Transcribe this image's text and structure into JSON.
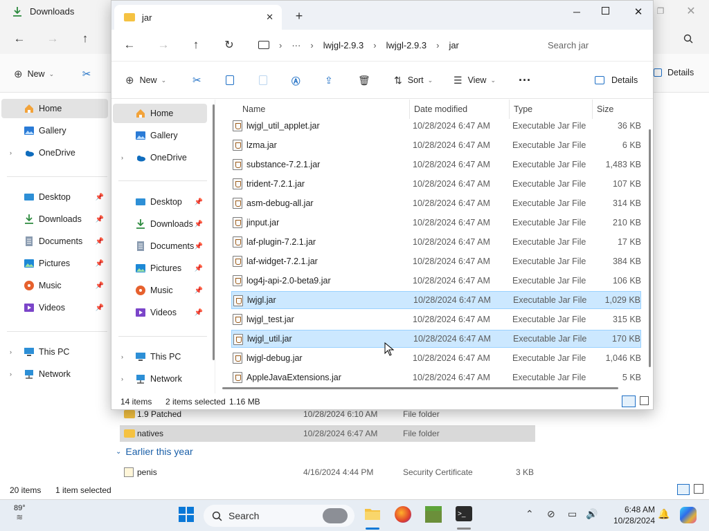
{
  "back_window": {
    "title": "Downloads",
    "toolbar": {
      "new_label": "New",
      "details_label": "Details"
    },
    "sidebar": {
      "home": "Home",
      "gallery": "Gallery",
      "onedrive": "OneDrive",
      "quick": [
        "Desktop",
        "Downloads",
        "Documents",
        "Pictures",
        "Music",
        "Videos"
      ],
      "this_pc": "This PC",
      "network": "Network"
    },
    "rows": [
      {
        "name": "1.9 Patched",
        "date": "10/28/2024 6:10 AM",
        "type": "File folder",
        "size": ""
      },
      {
        "name": "natives",
        "date": "10/28/2024 6:47 AM",
        "type": "File folder",
        "size": ""
      }
    ],
    "group_label": "Earlier this year",
    "extra_row": {
      "name": "penis",
      "date": "4/16/2024 4:44 PM",
      "type": "Security Certificate",
      "size": "3 KB"
    },
    "status": {
      "items": "20 items",
      "selected": "1 item selected"
    }
  },
  "front_window": {
    "tab_title": "jar",
    "breadcrumb": [
      "lwjgl-2.9.3",
      "lwjgl-2.9.3",
      "jar"
    ],
    "search_placeholder": "Search jar",
    "toolbar": {
      "new_label": "New",
      "sort_label": "Sort",
      "view_label": "View",
      "details_label": "Details"
    },
    "sidebar": {
      "home": "Home",
      "gallery": "Gallery",
      "onedrive": "OneDrive",
      "quick": [
        "Desktop",
        "Downloads",
        "Documents",
        "Pictures",
        "Music",
        "Videos"
      ],
      "this_pc": "This PC",
      "network": "Network"
    },
    "columns": {
      "name": "Name",
      "date": "Date modified",
      "type": "Type",
      "size": "Size"
    },
    "files": [
      {
        "name": "lwjgl_util_applet.jar",
        "date": "10/28/2024 6:47 AM",
        "type": "Executable Jar File",
        "size": "36 KB",
        "selected": false
      },
      {
        "name": "lzma.jar",
        "date": "10/28/2024 6:47 AM",
        "type": "Executable Jar File",
        "size": "6 KB",
        "selected": false
      },
      {
        "name": "substance-7.2.1.jar",
        "date": "10/28/2024 6:47 AM",
        "type": "Executable Jar File",
        "size": "1,483 KB",
        "selected": false
      },
      {
        "name": "trident-7.2.1.jar",
        "date": "10/28/2024 6:47 AM",
        "type": "Executable Jar File",
        "size": "107 KB",
        "selected": false
      },
      {
        "name": "asm-debug-all.jar",
        "date": "10/28/2024 6:47 AM",
        "type": "Executable Jar File",
        "size": "314 KB",
        "selected": false
      },
      {
        "name": "jinput.jar",
        "date": "10/28/2024 6:47 AM",
        "type": "Executable Jar File",
        "size": "210 KB",
        "selected": false
      },
      {
        "name": "laf-plugin-7.2.1.jar",
        "date": "10/28/2024 6:47 AM",
        "type": "Executable Jar File",
        "size": "17 KB",
        "selected": false
      },
      {
        "name": "laf-widget-7.2.1.jar",
        "date": "10/28/2024 6:47 AM",
        "type": "Executable Jar File",
        "size": "384 KB",
        "selected": false
      },
      {
        "name": "log4j-api-2.0-beta9.jar",
        "date": "10/28/2024 6:47 AM",
        "type": "Executable Jar File",
        "size": "106 KB",
        "selected": false
      },
      {
        "name": "lwjgl.jar",
        "date": "10/28/2024 6:47 AM",
        "type": "Executable Jar File",
        "size": "1,029 KB",
        "selected": true
      },
      {
        "name": "lwjgl_test.jar",
        "date": "10/28/2024 6:47 AM",
        "type": "Executable Jar File",
        "size": "315 KB",
        "selected": false
      },
      {
        "name": "lwjgl_util.jar",
        "date": "10/28/2024 6:47 AM",
        "type": "Executable Jar File",
        "size": "170 KB",
        "selected": true
      },
      {
        "name": "lwjgl-debug.jar",
        "date": "10/28/2024 6:47 AM",
        "type": "Executable Jar File",
        "size": "1,046 KB",
        "selected": false
      },
      {
        "name": "AppleJavaExtensions.jar",
        "date": "10/28/2024 6:47 AM",
        "type": "Executable Jar File",
        "size": "5 KB",
        "selected": false
      }
    ],
    "status": {
      "items": "14 items",
      "selected": "2 items selected",
      "size": "1.16 MB"
    }
  },
  "taskbar": {
    "weather": "89°",
    "search_label": "Search",
    "time": "6:48 AM",
    "date": "10/28/2024"
  }
}
